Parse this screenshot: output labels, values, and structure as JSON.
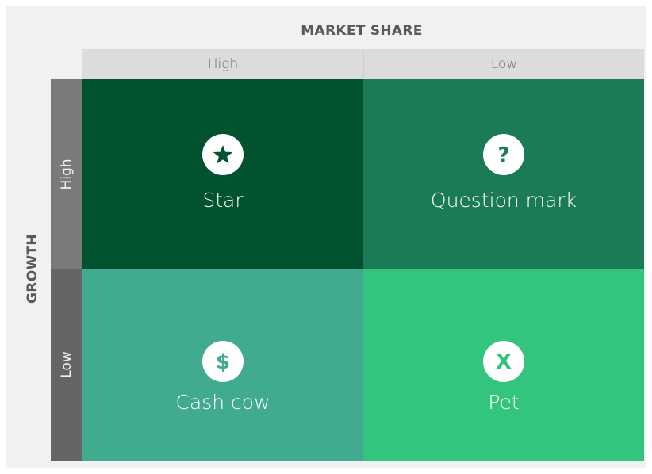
{
  "x_axis": {
    "title": "MARKET SHARE",
    "columns": [
      "High",
      "Low"
    ]
  },
  "y_axis": {
    "title": "GROWTH",
    "rows": [
      "High",
      "Low"
    ]
  },
  "quadrants": [
    {
      "label": "Star",
      "icon": "star-icon",
      "glyph": "★",
      "color": "#01522f"
    },
    {
      "label": "Question mark",
      "icon": "question-mark-icon",
      "glyph": "?",
      "color": "#1b7b57"
    },
    {
      "label": "Cash cow",
      "icon": "dollar-icon",
      "glyph": "$",
      "color": "#40ab8e"
    },
    {
      "label": "Pet",
      "icon": "x-icon",
      "glyph": "X",
      "color": "#33c57e"
    }
  ]
}
